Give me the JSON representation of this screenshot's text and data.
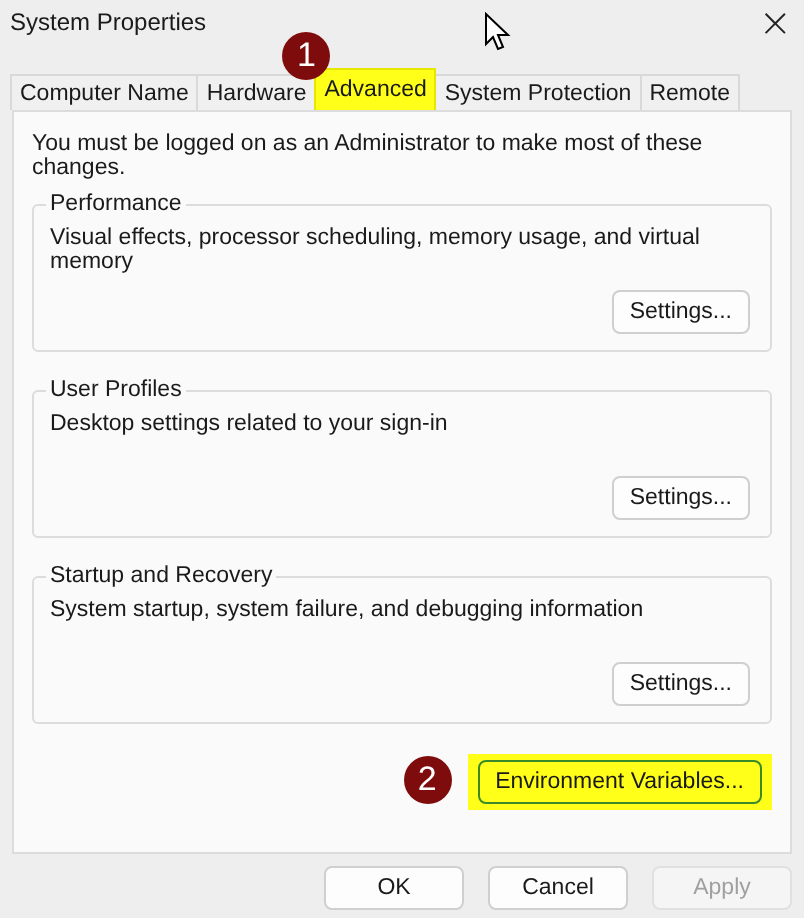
{
  "window": {
    "title": "System Properties",
    "close": "×"
  },
  "tabs": [
    {
      "label": "Computer Name",
      "selected": false,
      "highlighted": false
    },
    {
      "label": "Hardware",
      "selected": false,
      "highlighted": false
    },
    {
      "label": "Advanced",
      "selected": true,
      "highlighted": true,
      "badge": "1"
    },
    {
      "label": "System Protection",
      "selected": false,
      "highlighted": false
    },
    {
      "label": "Remote",
      "selected": false,
      "highlighted": false
    }
  ],
  "notice": "You must be logged on as an Administrator to make most of these changes.",
  "groups": [
    {
      "title": "Performance",
      "description": "Visual effects, processor scheduling, memory usage, and virtual memory",
      "button": "Settings..."
    },
    {
      "title": "User Profiles",
      "description": "Desktop settings related to your sign-in",
      "button": "Settings..."
    },
    {
      "title": "Startup and Recovery",
      "description": "System startup, system failure, and debugging information",
      "button": "Settings..."
    }
  ],
  "environment_button": {
    "label": "Environment Variables...",
    "highlighted": true,
    "badge": "2"
  },
  "buttons": [
    {
      "label": "OK",
      "disabled": false
    },
    {
      "label": "Cancel",
      "disabled": false
    },
    {
      "label": "Apply",
      "disabled": true
    }
  ]
}
